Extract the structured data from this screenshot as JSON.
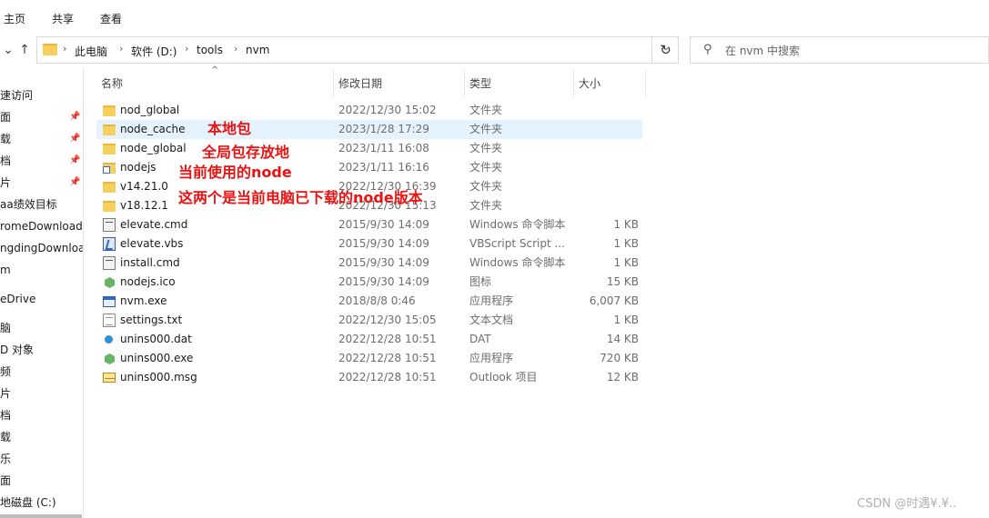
{
  "ribbon": {
    "tabs": [
      "主页",
      "共享",
      "查看"
    ]
  },
  "address": {
    "crumbs": [
      "此电脑",
      "软件 (D:)",
      "tools",
      "nvm"
    ]
  },
  "search": {
    "placeholder": "在 nvm 中搜索"
  },
  "sidebar": {
    "items": [
      {
        "label": "速访问",
        "pinned": false
      },
      {
        "label": "面",
        "pinned": true
      },
      {
        "label": "载",
        "pinned": true
      },
      {
        "label": "档",
        "pinned": true
      },
      {
        "label": "片",
        "pinned": true
      },
      {
        "label": "aa绩效目标",
        "pinned": false
      },
      {
        "label": "romeDownload",
        "pinned": false
      },
      {
        "label": "ngdingDownloa",
        "pinned": false
      },
      {
        "label": "m",
        "pinned": false
      },
      {
        "label": "eDrive",
        "pinned": false
      },
      {
        "label": "脑",
        "pinned": false
      },
      {
        "label": "D 对象",
        "pinned": false
      },
      {
        "label": "频",
        "pinned": false
      },
      {
        "label": "片",
        "pinned": false
      },
      {
        "label": "档",
        "pinned": false
      },
      {
        "label": "载",
        "pinned": false
      },
      {
        "label": "乐",
        "pinned": false
      },
      {
        "label": "面",
        "pinned": false
      },
      {
        "label": "地磁盘 (C:)",
        "pinned": false
      }
    ]
  },
  "columns": {
    "name": "名称",
    "date": "修改日期",
    "type": "类型",
    "size": "大小"
  },
  "files": [
    {
      "name": "nod_global",
      "date": "2022/12/30 15:02",
      "type": "文件夹",
      "size": "",
      "icon": "folder-icon"
    },
    {
      "name": "node_cache",
      "date": "2023/1/28 17:29",
      "type": "文件夹",
      "size": "",
      "icon": "folder-icon"
    },
    {
      "name": "node_global",
      "date": "2023/1/11 16:08",
      "type": "文件夹",
      "size": "",
      "icon": "folder-icon"
    },
    {
      "name": "nodejs",
      "date": "2023/1/11 16:16",
      "type": "文件夹",
      "size": "",
      "icon": "shortcut-folder-icon"
    },
    {
      "name": "v14.21.0",
      "date": "2022/12/30 16:39",
      "type": "文件夹",
      "size": "",
      "icon": "folder-icon"
    },
    {
      "name": "v18.12.1",
      "date": "2022/12/30 15:13",
      "type": "文件夹",
      "size": "",
      "icon": "folder-icon"
    },
    {
      "name": "elevate.cmd",
      "date": "2015/9/30 14:09",
      "type": "Windows 命令脚本",
      "size": "1 KB",
      "icon": "cmd-file-icon"
    },
    {
      "name": "elevate.vbs",
      "date": "2015/9/30 14:09",
      "type": "VBScript Script ...",
      "size": "1 KB",
      "icon": "vbs-file-icon"
    },
    {
      "name": "install.cmd",
      "date": "2015/9/30 14:09",
      "type": "Windows 命令脚本",
      "size": "1 KB",
      "icon": "cmd-file-icon"
    },
    {
      "name": "nodejs.ico",
      "date": "2015/9/30 14:09",
      "type": "图标",
      "size": "15 KB",
      "icon": "node-hex-icon"
    },
    {
      "name": "nvm.exe",
      "date": "2018/8/8 0:46",
      "type": "应用程序",
      "size": "6,007 KB",
      "icon": "exe-file-icon"
    },
    {
      "name": "settings.txt",
      "date": "2022/12/30 15:05",
      "type": "文本文档",
      "size": "1 KB",
      "icon": "text-file-icon"
    },
    {
      "name": "unins000.dat",
      "date": "2022/12/28 10:51",
      "type": "DAT",
      "size": "14 KB",
      "icon": "dat-file-icon"
    },
    {
      "name": "unins000.exe",
      "date": "2022/12/28 10:51",
      "type": "应用程序",
      "size": "720 KB",
      "icon": "node-hex-icon"
    },
    {
      "name": "unins000.msg",
      "date": "2022/12/28 10:51",
      "type": "Outlook 项目",
      "size": "12 KB",
      "icon": "mail-file-icon"
    }
  ],
  "selected_row": 1,
  "annotations": {
    "local_cache": "本地包",
    "global_store": "全局包存放地",
    "current_node": "当前使用的node",
    "downloaded_versions": "这两个是当前电脑已下载的node版本"
  },
  "annotation_color": "#ee1111",
  "watermark": "CSDN @时遇¥.¥.."
}
